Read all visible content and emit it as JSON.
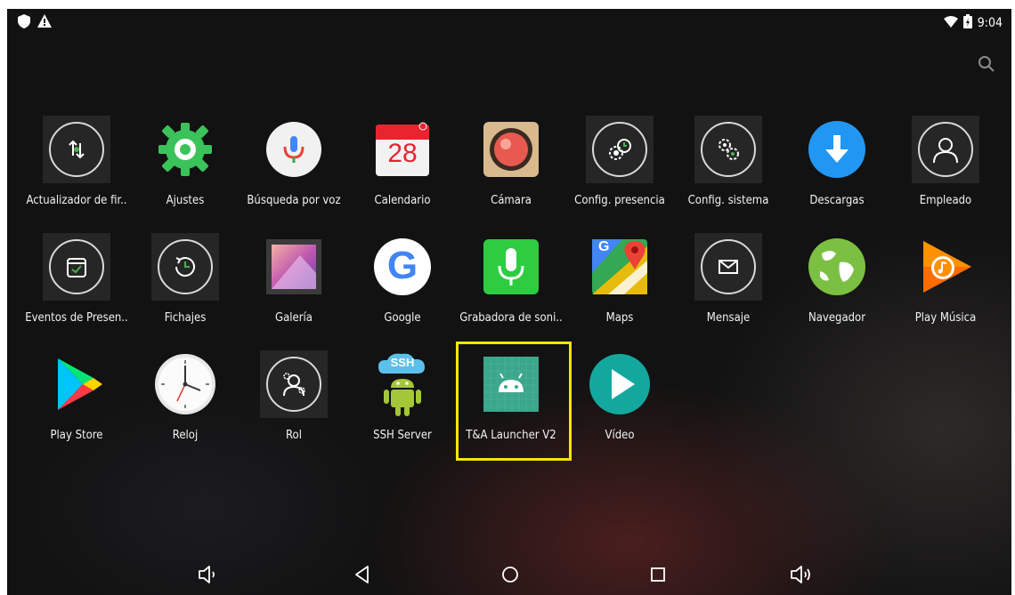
{
  "status": {
    "time": "9:04",
    "left_icons": [
      "shield-icon",
      "warning-icon"
    ],
    "right_icons": [
      "wifi-icon",
      "battery-charging-icon"
    ]
  },
  "search_icon": "search-icon",
  "apps": [
    {
      "label": "Actualizador de fir..",
      "icon": "update-icon"
    },
    {
      "label": "Ajustes",
      "icon": "settings-gear-icon"
    },
    {
      "label": "Búsqueda por voz",
      "icon": "mic-icon"
    },
    {
      "label": "Calendario",
      "icon": "calendar-icon",
      "day": "28"
    },
    {
      "label": "Cámara",
      "icon": "camera-icon"
    },
    {
      "label": "Config. presencia",
      "icon": "presence-config-icon"
    },
    {
      "label": "Config. sistema",
      "icon": "system-config-icon"
    },
    {
      "label": "Descargas",
      "icon": "download-icon"
    },
    {
      "label": "Empleado",
      "icon": "employee-icon"
    },
    {
      "label": "Eventos de Presen..",
      "icon": "events-icon"
    },
    {
      "label": "Fichajes",
      "icon": "clock-history-icon"
    },
    {
      "label": "Galería",
      "icon": "gallery-icon"
    },
    {
      "label": "Google",
      "icon": "google-icon",
      "glyph": "G"
    },
    {
      "label": "Grabadora de soni..",
      "icon": "sound-recorder-icon"
    },
    {
      "label": "Maps",
      "icon": "maps-icon",
      "glyph": "G"
    },
    {
      "label": "Mensaje",
      "icon": "message-icon"
    },
    {
      "label": "Navegador",
      "icon": "browser-globe-icon"
    },
    {
      "label": "Play Música",
      "icon": "play-music-icon"
    },
    {
      "label": "Play Store",
      "icon": "play-store-icon"
    },
    {
      "label": "Reloj",
      "icon": "clock-icon"
    },
    {
      "label": "Rol",
      "icon": "role-icon"
    },
    {
      "label": "SSH Server",
      "icon": "ssh-server-icon",
      "cloud_text": "SSH"
    },
    {
      "label": "T&A Launcher V2",
      "icon": "android-app-icon",
      "highlighted": true
    },
    {
      "label": "Vídeo",
      "icon": "video-play-icon"
    }
  ],
  "navbar": [
    "volume-down-icon",
    "back-icon",
    "home-icon",
    "recents-icon",
    "volume-up-icon"
  ],
  "colors": {
    "highlight": "#f6e600",
    "background": "#121212"
  }
}
